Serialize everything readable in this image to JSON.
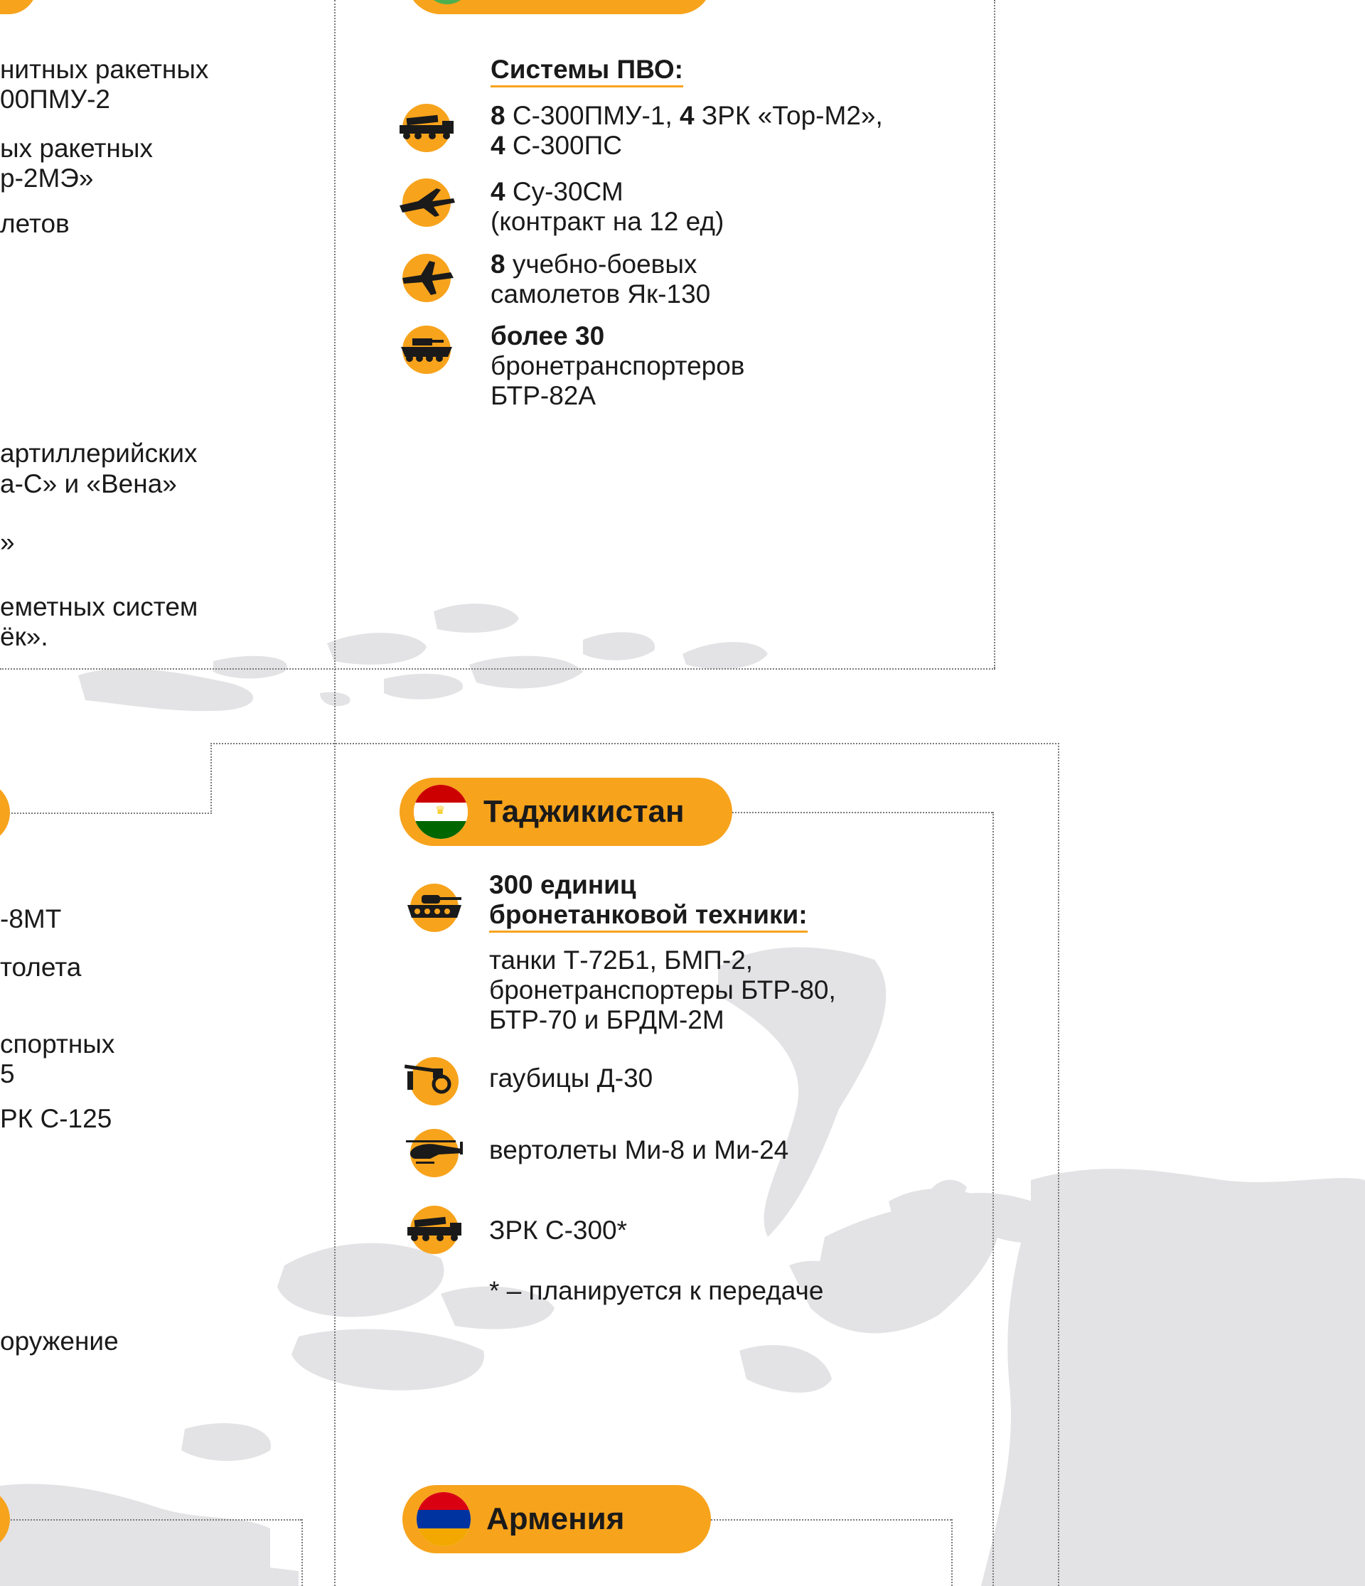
{
  "colors": {
    "accent": "#f7a31c",
    "map_gray": "#e3e3e5",
    "text": "#1a1a1a",
    "rule": "#7a7a7a"
  },
  "left_column": {
    "line1": "нитных ракетных",
    "line2": "00ПМУ-2",
    "line3": "ых ракетных",
    "line4": "р-2МЭ»",
    "line5": "летов",
    "line6": "артиллерийских",
    "line7": "а-С» и «Вена»",
    "line8": "»",
    "line9": "еметных систем",
    "line10": "ёк».",
    "line11": "-8МТ",
    "line12": "толета",
    "line13": "спортных",
    "line14": "5",
    "line15": "РК С-125",
    "line16": "оружение"
  },
  "air_defense_panel": {
    "heading": "Системы ПВО:",
    "item1": {
      "icon": "sam-launcher-truck-icon",
      "n1": "8",
      "t1": " С-300ПМУ-1, ",
      "n2": "4",
      "t2": " ЗРК «Тор-М2»,",
      "n3": "4",
      "t3": " С-300ПС"
    },
    "item2": {
      "icon": "fighter-jet-icon",
      "n1": "4",
      "t1": " Су-30СМ",
      "t2": "(контракт на 12 ед)"
    },
    "item3": {
      "icon": "trainer-jet-icon",
      "n1": "8",
      "t1": " учебно-боевых",
      "t2": "самолетов Як-130"
    },
    "item4": {
      "icon": "apc-icon",
      "bold": "более 30",
      "t1": "бронетранспортеров",
      "t2": "БТР-82А"
    }
  },
  "tajikistan": {
    "title": "Таджикистан",
    "flag": "tajikistan-flag-icon",
    "armor_heading_1": "300 единиц",
    "armor_heading_2": "бронетанковой техники:",
    "armor_line1": "танки Т-72Б1,  БМП-2,",
    "armor_line2": "бронетранспортеры БТР-80,",
    "armor_line3": "БТР-70 и БРДМ-2М",
    "howitzers": "гаубицы Д-30",
    "helicopters": "вертолеты Ми-8 и Ми-24",
    "sam": "ЗРК С-300*",
    "footnote": "* – планируется к передаче"
  },
  "armenia": {
    "title": "Армения",
    "flag": "armenia-flag-icon"
  }
}
